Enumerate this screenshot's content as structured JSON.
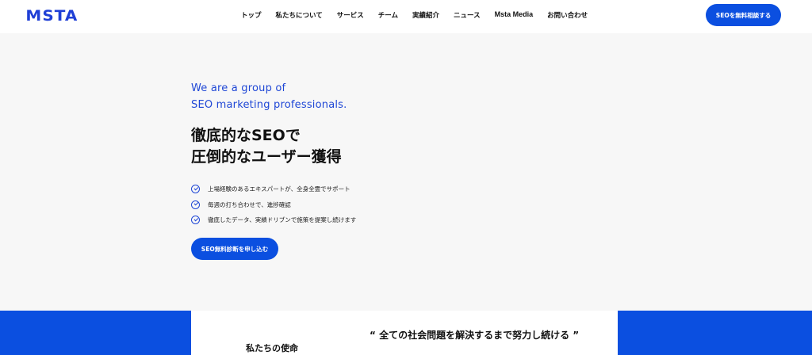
{
  "header": {
    "logo_text": "MSTA",
    "nav": [
      "トップ",
      "私たちについて",
      "サービス",
      "チーム",
      "実績紹介",
      "ニュース",
      "Msta Media",
      "お問い合わせ"
    ],
    "cta_label": "SEOを無料相談する"
  },
  "hero": {
    "tagline_line1": "We are a group of",
    "tagline_line2": "SEO marketing professionals.",
    "headline_line1": "徹底的なSEOで",
    "headline_line2": "圧倒的なユーザー獲得",
    "features": [
      "上場経験のあるエキスパートが、全身全霊でサポート",
      "毎週の打ち合わせで、進捗確認",
      "徹底したデータ、実績ドリブンで施策を提案し続けます"
    ],
    "cta_label": "SEO無料診断を申し込む"
  },
  "mission": {
    "title": "私たちの使命",
    "quote": "“ 全ての社会問題を解決するまで努力し続ける ”"
  },
  "colors": {
    "brand_blue": "#0b4fe0",
    "tagline_blue": "#1f47d6"
  }
}
